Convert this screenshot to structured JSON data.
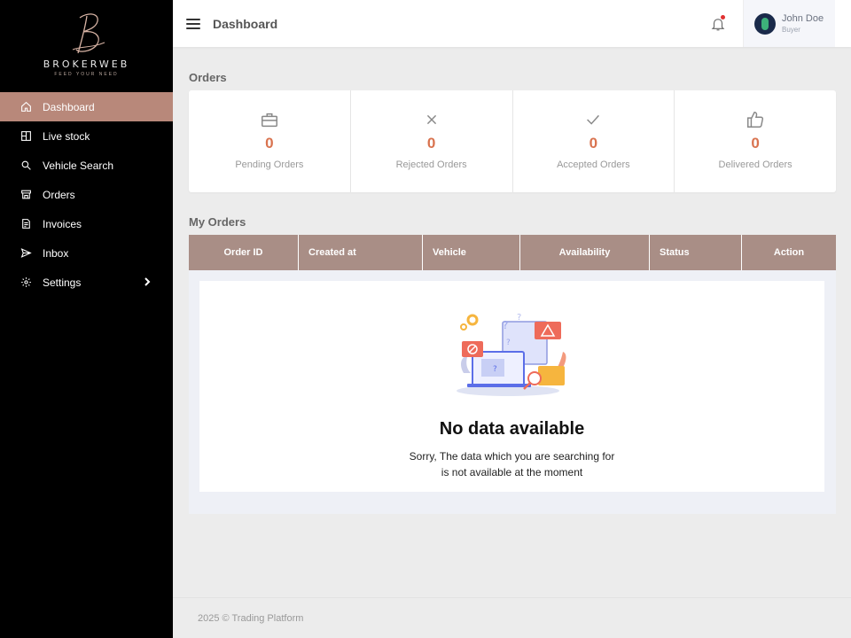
{
  "brand": {
    "name": "BROKERWEB",
    "tagline": "FEED YOUR NEED",
    "accent_color": "#b8887a"
  },
  "sidebar": {
    "items": [
      {
        "label": "Dashboard",
        "icon": "home-icon",
        "active": true
      },
      {
        "label": "Live stock",
        "icon": "grid-icon"
      },
      {
        "label": "Vehicle Search",
        "icon": "search-icon"
      },
      {
        "label": "Orders",
        "icon": "store-icon"
      },
      {
        "label": "Invoices",
        "icon": "invoice-icon"
      },
      {
        "label": "Inbox",
        "icon": "send-icon"
      },
      {
        "label": "Settings",
        "icon": "gear-icon",
        "has_submenu": true
      }
    ]
  },
  "header": {
    "title": "Dashboard",
    "user": {
      "name": "John Doe",
      "role": "Buyer"
    }
  },
  "orders": {
    "title": "Orders",
    "stats": [
      {
        "label": "Pending Orders",
        "value": "0",
        "icon": "briefcase-icon"
      },
      {
        "label": "Rejected Orders",
        "value": "0",
        "icon": "x-icon"
      },
      {
        "label": "Accepted Orders",
        "value": "0",
        "icon": "check-icon"
      },
      {
        "label": "Delivered Orders",
        "value": "0",
        "icon": "thumbs-up-icon"
      }
    ],
    "value_color": "#d9734f"
  },
  "my_orders": {
    "title": "My Orders",
    "columns": [
      "Order ID",
      "Created at",
      "Vehicle",
      "Availability",
      "Status",
      "Action"
    ],
    "header_color": "#a98e86",
    "empty": {
      "title": "No data available",
      "line1": "Sorry, The data which you are searching for",
      "line2": "is not available at the moment"
    }
  },
  "footer": {
    "text": "2025 © Trading Platform"
  }
}
